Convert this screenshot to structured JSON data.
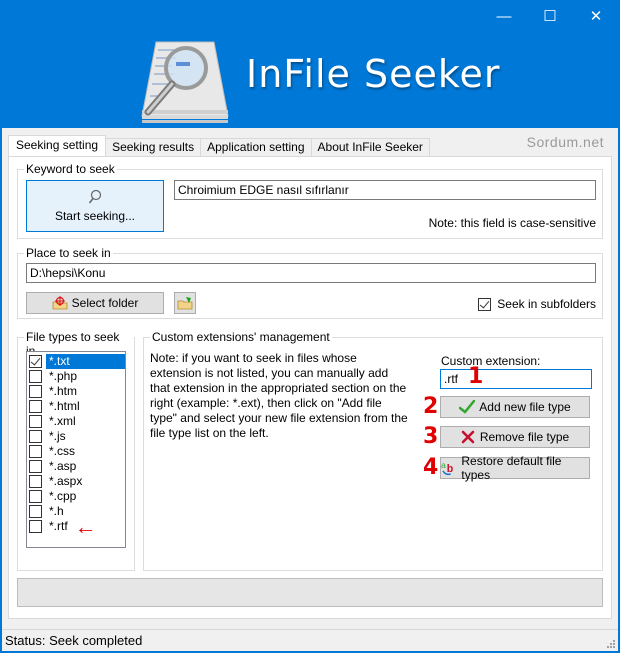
{
  "window": {
    "title": "InFile Seeker",
    "controls": {
      "minimize": "—",
      "maximize": "☐",
      "close": "✕"
    },
    "watermark": "Sordum.net"
  },
  "tabs": [
    {
      "label": "Seeking setting",
      "active": true
    },
    {
      "label": "Seeking results",
      "active": false
    },
    {
      "label": "Application setting",
      "active": false
    },
    {
      "label": "About InFile Seeker",
      "active": false
    }
  ],
  "keyword": {
    "legend": "Keyword to seek",
    "start_button": "Start seeking...",
    "value": "Chroimium EDGE nasıl sıfırlanır",
    "note": "Note: this field is case-sensitive"
  },
  "place": {
    "legend": "Place to seek in",
    "path": "D:\\hepsi\\Konu",
    "select_folder_button": "Select folder",
    "open_folder_button_icon": "folder-open-icon",
    "subfolders_label": "Seek in subfolders",
    "subfolders_checked": true
  },
  "file_types": {
    "legend": "File types to seek in",
    "items": [
      {
        "label": "*.txt",
        "checked": true,
        "selected": true
      },
      {
        "label": "*.php",
        "checked": false,
        "selected": false
      },
      {
        "label": "*.htm",
        "checked": false,
        "selected": false
      },
      {
        "label": "*.html",
        "checked": false,
        "selected": false
      },
      {
        "label": "*.xml",
        "checked": false,
        "selected": false
      },
      {
        "label": "*.js",
        "checked": false,
        "selected": false
      },
      {
        "label": "*.css",
        "checked": false,
        "selected": false
      },
      {
        "label": "*.asp",
        "checked": false,
        "selected": false
      },
      {
        "label": "*.aspx",
        "checked": false,
        "selected": false
      },
      {
        "label": "*.cpp",
        "checked": false,
        "selected": false
      },
      {
        "label": "*.h",
        "checked": false,
        "selected": false
      },
      {
        "label": "*.rtf",
        "checked": false,
        "selected": false
      }
    ],
    "annotation_arrow": "←"
  },
  "custom_ext": {
    "legend": "Custom extensions' management",
    "note": "Note: if you want to seek in files whose extension is not listed, you can manually add that extension in the appropriated section on the right (example: *.ext), then click on \"Add file type\" and select your new file extension from the file type list on the left.",
    "field_label": "Custom extension:",
    "field_value": ".rtf",
    "add_button": "Add new file type",
    "remove_button": "Remove file type",
    "restore_button": "Restore default file types",
    "annotations": [
      "1",
      "2",
      "3",
      "4"
    ]
  },
  "progress": {
    "value": 0
  },
  "status": {
    "text": "Status: Seek completed"
  },
  "colors": {
    "accent": "#0078d7",
    "annotation_red": "#e00000",
    "check_green": "#2ea82e",
    "remove_red": "#c8102e"
  }
}
